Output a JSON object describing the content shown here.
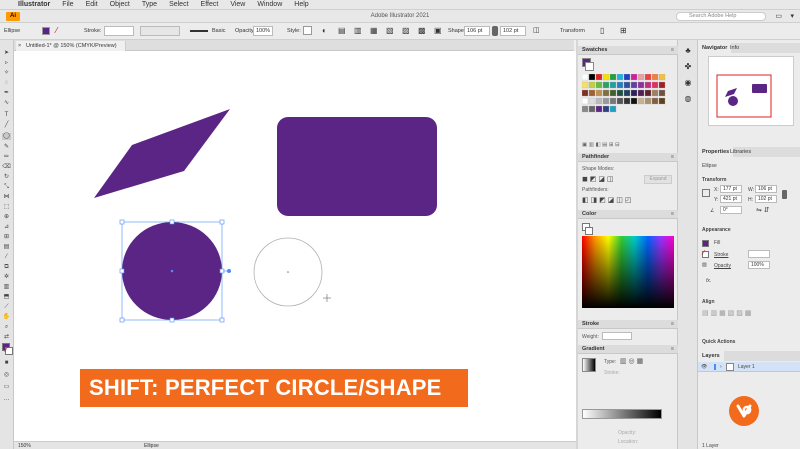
{
  "menubar": {
    "app_name": "Illustrator",
    "items": [
      "File",
      "Edit",
      "Object",
      "Type",
      "Select",
      "Effect",
      "View",
      "Window",
      "Help"
    ]
  },
  "titlebar": {
    "title": "Adobe Illustrator 2021",
    "search_placeholder": "Search Adobe Help",
    "logo_text": "Ai"
  },
  "controlbar": {
    "selection_label": "Ellipse",
    "stroke_label": "Stroke:",
    "brush_label": "Basic",
    "opacity_label": "Opacity:",
    "opacity_value": "100%",
    "style_label": "Style:",
    "shape_label": "Shape:",
    "width_value": "106 pt",
    "height_value": "102 pt",
    "transform_label": "Transform"
  },
  "document_tab": {
    "label": "Untitled-1* @ 150% (CMYK/Preview)",
    "close": "×"
  },
  "statusbar": {
    "zoom": "150%",
    "tool": "Ellipse"
  },
  "panels_left": {
    "swatches": "Swatches",
    "pathfinder": "Pathfinder",
    "shape_modes": "Shape Modes:",
    "expand": "Expand",
    "pathfinders": "Pathfinders:",
    "color": "Color",
    "stroke": "Stroke",
    "weight": "Weight:",
    "gradient": "Gradient",
    "type": "Type:",
    "stroke_row": "Stroke:",
    "opacity": "Opacity:",
    "location": "Location:",
    "menu": "≡"
  },
  "panels_right": {
    "navigator": "Navigator",
    "info": "Info",
    "properties": "Properties",
    "libraries": "Libraries",
    "ellipse": "Ellipse",
    "transform": "Transform",
    "x_label": "X:",
    "x_value": "177 pt",
    "y_label": "Y:",
    "y_value": "421 pt",
    "w_label": "W:",
    "w_value": "106 pt",
    "h_label": "H:",
    "h_value": "102 pt",
    "angle_value": "0°",
    "appearance": "Appearance",
    "fill": "Fill",
    "stroke": "Stroke",
    "opacity": "Opacity",
    "opacity_value": "100%",
    "fx": "fx.",
    "align": "Align",
    "quick_actions": "Quick Actions",
    "layers": "Layers",
    "layer_name": "Layer 1",
    "layer_count": "1 Layer"
  },
  "banner": {
    "text": "SHIFT: PERFECT CIRCLE/SHAPE"
  },
  "colors": {
    "purple": "#5b2585",
    "orange": "#f26a1b",
    "selection": "#4a8cf7"
  },
  "icons": [
    "apple-icon",
    "search-icon",
    "selection-tool-icon",
    "close-icon",
    "layer-eye-icon",
    "brand-logo-icon"
  ]
}
